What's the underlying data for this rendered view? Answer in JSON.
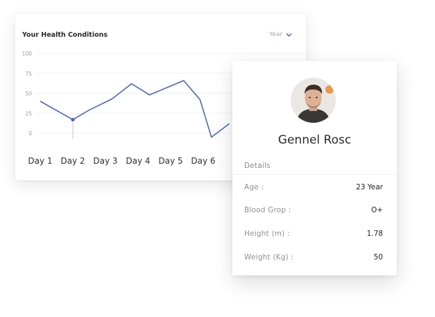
{
  "health_card": {
    "title": "Your Health Conditions",
    "period_label": "Year"
  },
  "chart_data": {
    "type": "line",
    "title": "",
    "xlabel": "",
    "ylabel": "",
    "categories": [
      "Day 1",
      "Day 2",
      "Day 3",
      "Day 4",
      "Day 5",
      "Day 6"
    ],
    "y_ticks": [
      "100",
      "75",
      "50",
      "25",
      "0"
    ],
    "ylim": [
      0,
      100
    ],
    "series": [
      {
        "values": [
          {
            "x": 0.0,
            "y": 40
          },
          {
            "x": 1.0,
            "y": 17
          },
          {
            "x": 1.5,
            "y": 29
          },
          {
            "x": 2.2,
            "y": 43
          },
          {
            "x": 2.8,
            "y": 62
          },
          {
            "x": 3.35,
            "y": 48
          },
          {
            "x": 4.4,
            "y": 66
          },
          {
            "x": 4.9,
            "y": 42
          },
          {
            "x": 5.25,
            "y": -5
          },
          {
            "x": 5.8,
            "y": 12
          }
        ],
        "color": "#4a63c6"
      }
    ],
    "highlight_index": 1,
    "grid": true,
    "legend": "none"
  },
  "profile": {
    "name": "Gennel Rosc",
    "details_heading": "Details",
    "fields": [
      {
        "label": "Age :",
        "value": "23 Year"
      },
      {
        "label": "Blood Grop :",
        "value": "O+"
      },
      {
        "label": "Height (m) :",
        "value": "1.78"
      },
      {
        "label": "Weight (Kg) :",
        "value": "50"
      }
    ]
  },
  "colors": {
    "accent": "#4a63c6",
    "grid": "#f1f1f1",
    "muted_text": "#8f8f8f"
  }
}
